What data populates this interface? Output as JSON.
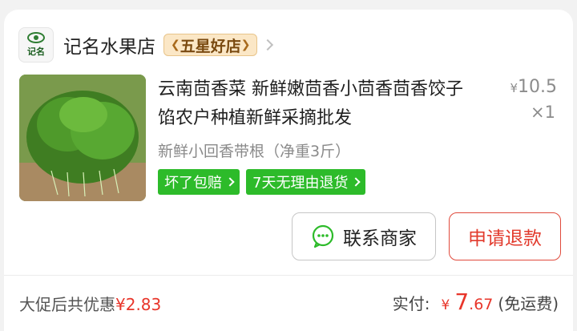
{
  "shop": {
    "logo_text": "记名",
    "name": "记名水果店",
    "badge": "五星好店"
  },
  "product": {
    "title": "云南茴香菜 新鲜嫩茴香小茴香茴香饺子馅农户种植新鲜采摘批发",
    "price_symbol": "¥",
    "price": "10.5",
    "quantity": "×1",
    "sku": "新鲜小回香带根（净重3斤）",
    "tags": [
      "坏了包赔",
      "7天无理由退货"
    ]
  },
  "actions": {
    "contact_label": "联系商家",
    "refund_label": "申请退款"
  },
  "summary": {
    "promo_label": "大促后共优惠",
    "promo_amount": "¥2.83",
    "paid_label": "实付:",
    "paid_symbol": "¥",
    "paid_int": "7",
    "paid_dec": ".67",
    "shipping": "(免运费)"
  },
  "colors": {
    "accent_red": "#e8352a",
    "tag_green": "#2dbb2a",
    "badge_bg": "#fbe7c6"
  }
}
